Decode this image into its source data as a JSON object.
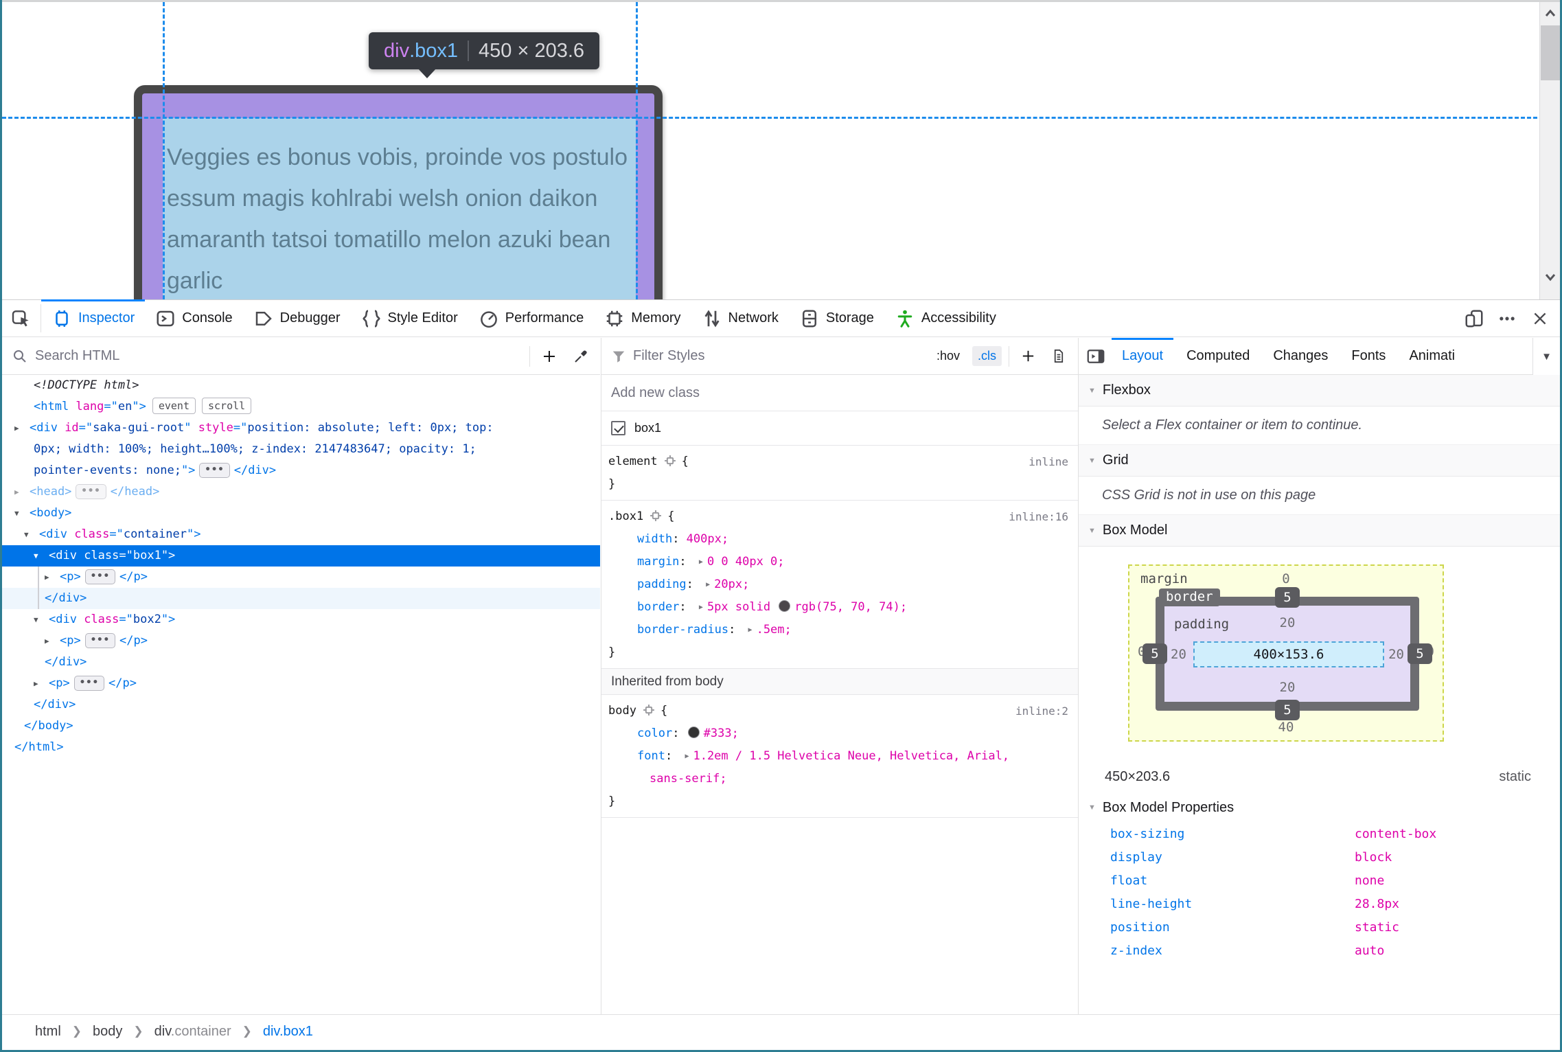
{
  "colors": {
    "accent": "#0074e8",
    "selection_blue": "#0074e8",
    "attr_pink": "#dd00a9",
    "value_navy": "#003eaa",
    "highlight_purple": "#a791e3",
    "highlight_blue": "#abd3ea",
    "guide_blue": "#1d8cec",
    "margin_yellow": "#fcffe0",
    "padding_lavender": "#e4dcf6",
    "content_cyan": "#d0eefc",
    "accessibility_green": "#1faa1f"
  },
  "page": {
    "tooltip": {
      "tag": "div",
      "cls": ".box1",
      "dims": "450 × 203.6"
    },
    "paragraph_lines": [
      "Veggies es bonus vobis, proinde vos postulo",
      "essum magis kohlrabi welsh onion daikon",
      "amaranth tatsoi tomatillo melon azuki bean",
      "garlic"
    ]
  },
  "toolbar": {
    "tabs": [
      {
        "label": "Inspector",
        "icon": "inspector-icon",
        "active": true
      },
      {
        "label": "Console",
        "icon": "console-icon",
        "active": false
      },
      {
        "label": "Debugger",
        "icon": "debugger-icon",
        "active": false
      },
      {
        "label": "Style Editor",
        "icon": "style-editor-icon",
        "active": false
      },
      {
        "label": "Performance",
        "icon": "performance-icon",
        "active": false
      },
      {
        "label": "Memory",
        "icon": "memory-icon",
        "active": false
      },
      {
        "label": "Network",
        "icon": "network-icon",
        "active": false
      },
      {
        "label": "Storage",
        "icon": "storage-icon",
        "active": false
      },
      {
        "label": "Accessibility",
        "icon": "accessibility-icon",
        "active": false,
        "green": true
      }
    ]
  },
  "markup": {
    "search_placeholder": "Search HTML",
    "rows": [
      {
        "pad": 46,
        "tokens": [
          {
            "c": "doctype",
            "t": "<!DOCTYPE html>"
          }
        ]
      },
      {
        "pad": 46,
        "tokens": [
          {
            "c": "tag",
            "t": "<html"
          },
          {
            "c": "attr",
            "t": " lang"
          },
          {
            "c": "pun",
            "t": "=\""
          },
          {
            "c": "val",
            "t": "en"
          },
          {
            "c": "pun",
            "t": "\">"
          }
        ],
        "badges": [
          "event",
          "scroll"
        ]
      },
      {
        "pad": 18,
        "arrow": ">",
        "tokens": [
          {
            "c": "tag",
            "t": "<div"
          },
          {
            "c": "attr",
            "t": " id"
          },
          {
            "c": "pun",
            "t": "=\""
          },
          {
            "c": "val",
            "t": "saka-gui-root"
          },
          {
            "c": "pun",
            "t": "\""
          },
          {
            "c": "attr",
            "t": " style"
          },
          {
            "c": "pun",
            "t": "=\""
          },
          {
            "c": "val",
            "t": "position: absolute; left: 0px; top:"
          }
        ]
      },
      {
        "pad": 46,
        "tokens": [
          {
            "c": "val",
            "t": "0px; width: 100%; height…100%; z-index: 2147483647; opacity: 1;"
          }
        ]
      },
      {
        "pad": 46,
        "tokens": [
          {
            "c": "val",
            "t": "pointer-events: none;"
          },
          {
            "c": "pun",
            "t": "\">"
          },
          {
            "c": "dots"
          },
          {
            "c": "tag",
            "t": "</div>"
          }
        ]
      },
      {
        "pad": 18,
        "arrow": ">",
        "cls": "dim",
        "tokens": [
          {
            "c": "tag",
            "t": "<head>"
          },
          {
            "c": "dots"
          },
          {
            "c": "tag",
            "t": "</head>"
          }
        ]
      },
      {
        "pad": 18,
        "arrow": "v",
        "tokens": [
          {
            "c": "tag",
            "t": "<body>"
          }
        ]
      },
      {
        "pad": 32,
        "arrow": "v",
        "tokens": [
          {
            "c": "tag",
            "t": "<div"
          },
          {
            "c": "attr",
            "t": " class"
          },
          {
            "c": "pun",
            "t": "=\""
          },
          {
            "c": "val",
            "t": "container"
          },
          {
            "c": "pun",
            "t": "\">"
          }
        ]
      },
      {
        "pad": 46,
        "arrow": "v",
        "cls": "selected",
        "tokens": [
          {
            "c": "tag",
            "t": "<div"
          },
          {
            "c": "attr",
            "t": " class"
          },
          {
            "c": "pun",
            "t": "=\""
          },
          {
            "c": "val",
            "t": "box1"
          },
          {
            "c": "pun",
            "t": "\">"
          }
        ]
      },
      {
        "pad": 62,
        "arrow": ">",
        "guide": 52,
        "tokens": [
          {
            "c": "tag",
            "t": "<p>"
          },
          {
            "c": "dots"
          },
          {
            "c": "tag",
            "t": "</p>"
          }
        ]
      },
      {
        "pad": 62,
        "guide": 52,
        "cls": "childbg",
        "tokens": [
          {
            "c": "tag",
            "t": "</div>"
          }
        ]
      },
      {
        "pad": 46,
        "arrow": "v",
        "tokens": [
          {
            "c": "tag",
            "t": "<div"
          },
          {
            "c": "attr",
            "t": " class"
          },
          {
            "c": "pun",
            "t": "=\""
          },
          {
            "c": "val",
            "t": "box2"
          },
          {
            "c": "pun",
            "t": "\">"
          }
        ]
      },
      {
        "pad": 62,
        "arrow": ">",
        "tokens": [
          {
            "c": "tag",
            "t": "<p>"
          },
          {
            "c": "dots"
          },
          {
            "c": "tag",
            "t": "</p>"
          }
        ]
      },
      {
        "pad": 62,
        "tokens": [
          {
            "c": "tag",
            "t": "</div>"
          }
        ]
      },
      {
        "pad": 46,
        "arrow": ">",
        "tokens": [
          {
            "c": "tag",
            "t": "<p>"
          },
          {
            "c": "dots"
          },
          {
            "c": "tag",
            "t": "</p>"
          }
        ]
      },
      {
        "pad": 46,
        "tokens": [
          {
            "c": "tag",
            "t": "</div>"
          }
        ]
      },
      {
        "pad": 32,
        "tokens": [
          {
            "c": "tag",
            "t": "</body>"
          }
        ]
      },
      {
        "pad": 18,
        "tokens": [
          {
            "c": "tag",
            "t": "</html>"
          }
        ]
      }
    ]
  },
  "rules": {
    "filter_placeholder": "Filter Styles",
    "hov_label": ":hov",
    "cls_label": ".cls",
    "add_class_placeholder": "Add new class",
    "class_toggle_label": "box1",
    "blocks": [
      {
        "selector": "element",
        "link": "inline",
        "props": []
      },
      {
        "selector": ".box1",
        "link": "inline:16",
        "props": [
          {
            "name": "width",
            "parts": [
              {
                "t": "400px;"
              }
            ]
          },
          {
            "name": "margin",
            "arrow": true,
            "parts": [
              {
                "t": "0 0 40px 0;"
              }
            ]
          },
          {
            "name": "padding",
            "arrow": true,
            "parts": [
              {
                "t": "20px;"
              }
            ]
          },
          {
            "name": "border",
            "arrow": true,
            "parts": [
              {
                "t": "5px solid "
              },
              {
                "swatch": "#4b464a"
              },
              {
                "t": "rgb(75, 70, 74);"
              }
            ]
          },
          {
            "name": "border-radius",
            "arrow": true,
            "parts": [
              {
                "t": ".5em;"
              }
            ]
          }
        ]
      },
      {
        "header": "Inherited from body"
      },
      {
        "selector": "body",
        "link": "inline:2",
        "props": [
          {
            "name": "color",
            "parts": [
              {
                "swatch": "#333333"
              },
              {
                "t": "#333;"
              }
            ]
          },
          {
            "name": "font",
            "arrow": true,
            "parts": [
              {
                "t": "1.2em / 1.5 Helvetica Neue, Helvetica, Arial,"
              }
            ],
            "wrap": "sans-serif;"
          }
        ]
      }
    ]
  },
  "layout": {
    "tabs": [
      {
        "label": "Layout",
        "active": true
      },
      {
        "label": "Computed"
      },
      {
        "label": "Changes"
      },
      {
        "label": "Fonts"
      },
      {
        "label": "Animati",
        "clip": true
      }
    ],
    "flexbox_title": "Flexbox",
    "flexbox_msg": "Select a Flex container or item to continue.",
    "grid_title": "Grid",
    "grid_msg": "CSS Grid is not in use on this page",
    "boxmodel_title": "Box Model",
    "diagram": {
      "margin_label": "margin",
      "border_label": "border",
      "padding_label": "padding",
      "margin_top": "0",
      "margin_bottom": "40",
      "margin_left": "0",
      "margin_right": "0",
      "border_top": "5",
      "border_bottom": "5",
      "border_left": "5",
      "border_right": "5",
      "padding_top": "20",
      "padding_bottom": "20",
      "padding_left": "20",
      "padding_right": "20",
      "content": "400×153.6"
    },
    "dims": "450×203.6",
    "position": "static",
    "properties_title": "Box Model Properties",
    "properties": [
      {
        "name": "box-sizing",
        "value": "content-box"
      },
      {
        "name": "display",
        "value": "block"
      },
      {
        "name": "float",
        "value": "none"
      },
      {
        "name": "line-height",
        "value": "28.8px"
      },
      {
        "name": "position",
        "value": "static"
      },
      {
        "name": "z-index",
        "value": "auto"
      }
    ]
  },
  "breadcrumbs": [
    {
      "tag": "html"
    },
    {
      "tag": "body"
    },
    {
      "tag": "div",
      "cls": ".container"
    },
    {
      "tag": "div.box1",
      "selected": true
    }
  ]
}
